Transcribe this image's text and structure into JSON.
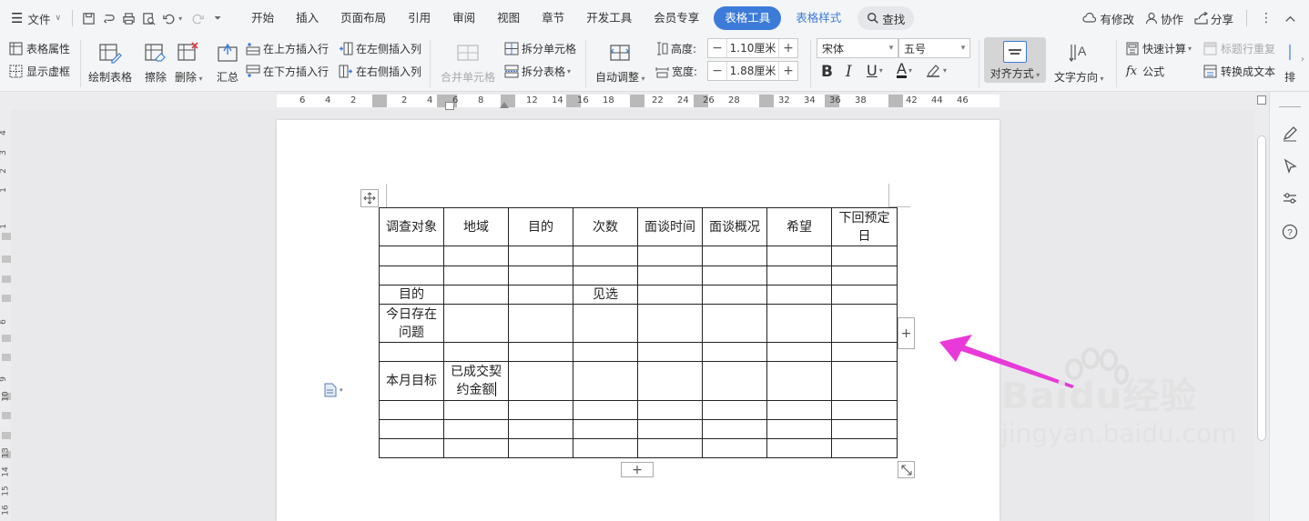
{
  "menubar": {
    "file_label": "文件",
    "tabs": [
      {
        "label": "开始"
      },
      {
        "label": "插入"
      },
      {
        "label": "页面布局"
      },
      {
        "label": "引用"
      },
      {
        "label": "审阅"
      },
      {
        "label": "视图"
      },
      {
        "label": "章节"
      },
      {
        "label": "开发工具"
      },
      {
        "label": "会员专享"
      }
    ],
    "table_tools": "表格工具",
    "table_style": "表格样式",
    "search": "查找",
    "modified": "有修改",
    "collab": "协作",
    "share": "分享"
  },
  "ribbon": {
    "table_props": "表格属性",
    "show_gridlines": "显示虚框",
    "draw_table": "绘制表格",
    "eraser": "擦除",
    "delete": "删除",
    "summary": "汇总",
    "insert_above": "在上方插入行",
    "insert_below": "在下方插入行",
    "insert_left": "在左侧插入列",
    "insert_right": "在右侧插入列",
    "merge_cells": "合并单元格",
    "split_cells": "拆分单元格",
    "split_table": "拆分表格",
    "auto_adjust": "自动调整",
    "height_label": "高度:",
    "height_value": "1.10厘米",
    "width_label": "宽度:",
    "width_value": "1.88厘米",
    "font_name": "宋体",
    "font_size": "五号",
    "bold": "B",
    "italic": "I",
    "underline": "U",
    "font_color": "A",
    "align": "对齐方式",
    "text_direction": "文字方向",
    "quick_calc": "快速计算",
    "repeat_header": "标题行重复",
    "formula": "公式",
    "convert_text": "转换成文本",
    "sort_partial": "排"
  },
  "ruler": {
    "ticks": [
      "6",
      "4",
      "2",
      "2",
      "4",
      "6",
      "8",
      "12",
      "14",
      "16",
      "18",
      "22",
      "24",
      "26",
      "28",
      "32",
      "34",
      "36",
      "38",
      "42",
      "44",
      "46"
    ],
    "vticks": [
      "4",
      "3",
      "2",
      "1",
      "1",
      "6",
      "9",
      "10",
      "13",
      "14",
      "15",
      "16"
    ]
  },
  "table": {
    "rows": [
      [
        "调查对象",
        "地域",
        "目的",
        "次数",
        "面谈时间",
        "面谈概况",
        "希望",
        "下回预定日"
      ],
      [
        "",
        "",
        "",
        "",
        "",
        "",
        "",
        ""
      ],
      [
        "",
        "",
        "",
        "",
        "",
        "",
        "",
        ""
      ],
      [
        "目的",
        "",
        "",
        "见选",
        "",
        "",
        "",
        ""
      ],
      [
        "今日存在问题",
        "",
        "",
        "",
        "",
        "",
        "",
        ""
      ],
      [
        "",
        "",
        "",
        "",
        "",
        "",
        "",
        ""
      ],
      [
        "本月目标",
        "已成交契约金额",
        "",
        "",
        "",
        "",
        "",
        ""
      ],
      [
        "",
        "",
        "",
        "",
        "",
        "",
        "",
        ""
      ],
      [
        "",
        "",
        "",
        "",
        "",
        "",
        "",
        ""
      ],
      [
        "",
        "",
        "",
        "",
        "",
        "",
        "",
        ""
      ]
    ]
  },
  "watermark": {
    "logo": "Baidu经验",
    "url": "jingyan.baidu.com"
  },
  "colors": {
    "accent": "#3d7bd9",
    "arrow": "#e83ad8"
  }
}
